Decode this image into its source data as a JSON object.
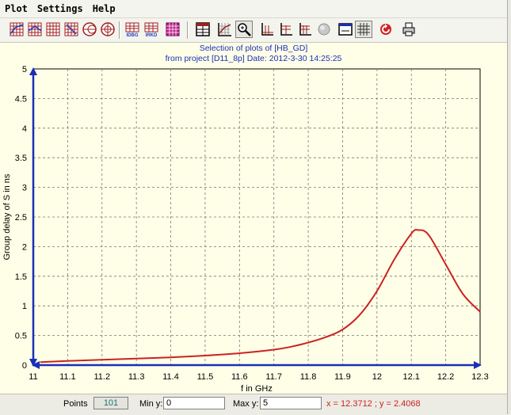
{
  "menu": [
    "Plot",
    "Settings",
    "Help"
  ],
  "toolbar": {
    "groups": [
      [
        "plot-type-1-icon",
        "plot-type-2-icon",
        "plot-type-3-icon",
        "plot-type-4-icon",
        "smith-chart-icon",
        "polar-chart-icon"
      ],
      [
        "idbg-icon",
        "irkd-icon",
        "marker-plot-icon"
      ],
      [
        "frame-icon",
        "grid-plot-icon",
        "zoom-icon",
        "axis-1-icon",
        "axis-2-icon",
        "axis-3-icon",
        "circle-gray-icon",
        "display-icon",
        "grid-toggle-icon",
        "refresh-icon",
        "print-icon"
      ]
    ]
  },
  "chart": {
    "title_line1": "Selection of plots of [HB_GD]",
    "title_line2": "from project [D11_8p]     Date: 2012-3-30 14:25:25",
    "curve_color": "#cc2222",
    "axis_color": "#1a2fb8",
    "grid_color": "#777777",
    "background": "#ffffe7"
  },
  "chart_data": {
    "type": "line",
    "xlabel": "f in GHz",
    "ylabel": "Group delay of S in ns",
    "xlim": [
      11,
      12.3
    ],
    "ylim": [
      0,
      5
    ],
    "xticks": [
      "11",
      "11.1",
      "11.2",
      "11.3",
      "11.4",
      "11.5",
      "11.6",
      "11.7",
      "11.8",
      "11.9",
      "12",
      "12.1",
      "12.2",
      "12.3"
    ],
    "yticks": [
      "0",
      "0.5",
      "1",
      "1.5",
      "2",
      "2.5",
      "3",
      "3.5",
      "4",
      "4.5",
      "5"
    ],
    "grid": true,
    "series": [
      {
        "x": [
          11.02,
          11.1,
          11.2,
          11.3,
          11.4,
          11.5,
          11.6,
          11.7,
          11.75,
          11.8,
          11.85,
          11.9,
          11.95,
          12.0,
          12.05,
          12.1,
          12.12,
          12.15,
          12.2,
          12.25,
          12.3
        ],
        "values": [
          0.05,
          0.07,
          0.09,
          0.11,
          0.13,
          0.16,
          0.2,
          0.26,
          0.31,
          0.38,
          0.47,
          0.6,
          0.85,
          1.25,
          1.78,
          2.22,
          2.28,
          2.2,
          1.7,
          1.2,
          0.9
        ]
      }
    ]
  },
  "status": {
    "points_label": "Points",
    "points_value": "101",
    "miny_label": "Min y:",
    "miny_value": "0",
    "maxy_label": "Max y:",
    "maxy_value": "5",
    "coord_text": "x = 12.3712 ; y = 2.4068"
  }
}
